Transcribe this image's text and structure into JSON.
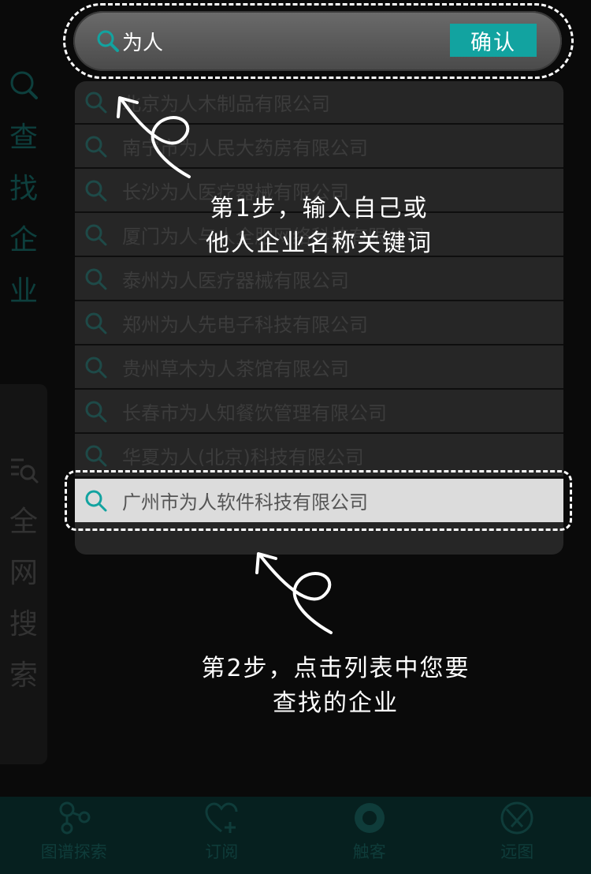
{
  "sidebar": {
    "find_company": {
      "label_chars": [
        "查",
        "找",
        "企",
        "业"
      ]
    },
    "web_search": {
      "label_chars": [
        "全",
        "网",
        "搜",
        "索"
      ]
    }
  },
  "search": {
    "value": "为人",
    "confirm_label": "确认",
    "icon": "search-icon"
  },
  "results": [
    "北京为人木制品有限公司",
    "南宁市为人民大药房有限公司",
    "长沙为人医疗器械有限公司",
    "厦门为人与人全服网络科技有限公司",
    "泰州为人医疗器械有限公司",
    "郑州为人先电子科技有限公司",
    "贵州草木为人茶馆有限公司",
    "长春市为人知餐饮管理有限公司",
    "华夏为人(北京)科技有限公司"
  ],
  "highlighted_result": "广州市为人软件科技有限公司",
  "hints": {
    "step1": [
      "第1步，输入自己或",
      "他人企业名称关键词"
    ],
    "step2": [
      "第2步，点击列表中您要",
      "查找的企业"
    ]
  },
  "bottom_nav": [
    {
      "label": "图谱探索",
      "icon": "graph-nodes-icon"
    },
    {
      "label": "订阅",
      "icon": "heart-plus-icon"
    },
    {
      "label": "触客",
      "icon": "target-circle-icon"
    },
    {
      "label": "远图",
      "icon": "aperture-icon"
    }
  ],
  "colors": {
    "accent": "#12a3a0",
    "overlay": "#000000",
    "outline": "#ffffff"
  }
}
